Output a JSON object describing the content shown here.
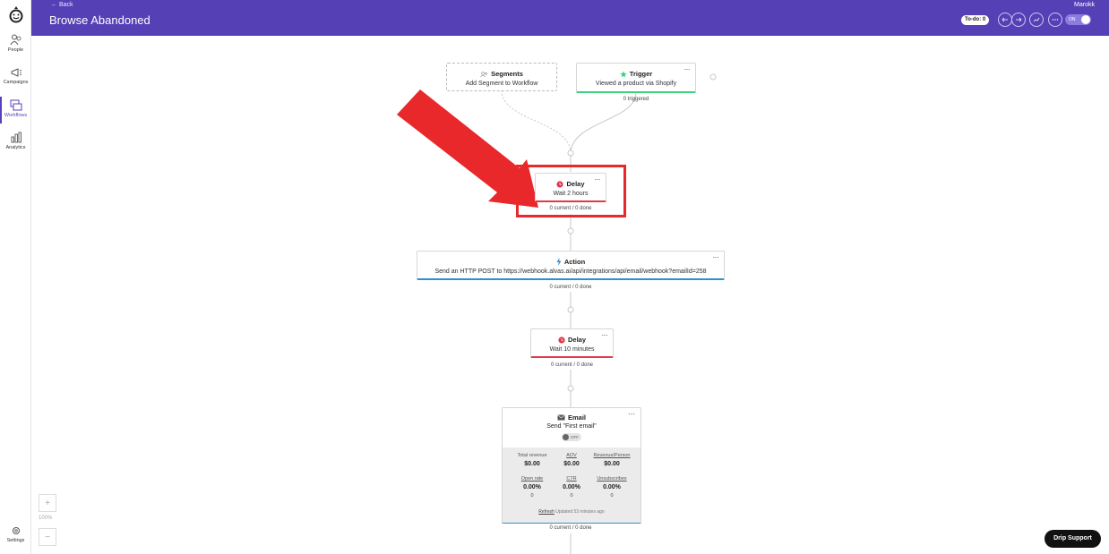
{
  "nav": {
    "items": [
      {
        "label": "People",
        "icon": "people-icon"
      },
      {
        "label": "Campaigns",
        "icon": "megaphone-icon"
      },
      {
        "label": "Workflows",
        "icon": "workflow-icon"
      },
      {
        "label": "Analytics",
        "icon": "analytics-icon"
      }
    ],
    "settings_label": "Settings"
  },
  "header": {
    "back_label": "← Back",
    "title": "Browse Abandoned",
    "account": "Marokk",
    "todo_label": "To-do: 0",
    "toggle_label": "ON"
  },
  "workflow": {
    "segments": {
      "title": "Segments",
      "subtitle": "Add Segment to Workflow"
    },
    "trigger": {
      "title": "Trigger",
      "subtitle": "Viewed a product via Shopify",
      "stat": "0 triggered",
      "menu": "···"
    },
    "delay1": {
      "title": "Delay",
      "subtitle": "Wait 2 hours",
      "stat": "0 current / 0 done",
      "menu": "···"
    },
    "action": {
      "title": "Action",
      "subtitle": "Send an HTTP POST to https://webhook.alvas.ai/api/integrations/api/email/webhook?emailId=258",
      "stat": "0 current / 0 done",
      "menu": "···"
    },
    "delay2": {
      "title": "Delay",
      "subtitle": "Wait 10 minutes",
      "stat": "0 current / 0 done",
      "menu": "···"
    },
    "email": {
      "title": "Email",
      "subtitle": "Send \"First email\"",
      "toggle": "OFF",
      "menu": "···",
      "metrics": [
        {
          "label": "Total revenue",
          "value": "$0.00",
          "count": ""
        },
        {
          "label": "AOV",
          "value": "$0.00",
          "count": ""
        },
        {
          "label": "Revenue/Person",
          "value": "$0.00",
          "count": ""
        },
        {
          "label": "Open rate",
          "value": "0.00%",
          "count": "0"
        },
        {
          "label": "CTR",
          "value": "0.00%",
          "count": "0"
        },
        {
          "label": "Unsubscribes",
          "value": "0.00%",
          "count": "0"
        }
      ],
      "refresh_label": "Refresh",
      "updated_text": "Updated 53 minutes ago",
      "stat": "0 current / 0 done"
    }
  },
  "zoom": {
    "plus": "+",
    "minus": "−",
    "level": "100%"
  },
  "support_label": "Drip Support",
  "colors": {
    "header": "#5540b5",
    "trigger_accent": "#3fcf7d",
    "delay_accent": "#e03a4a",
    "action_accent": "#2f8fd1",
    "highlight": "#e8282a"
  }
}
